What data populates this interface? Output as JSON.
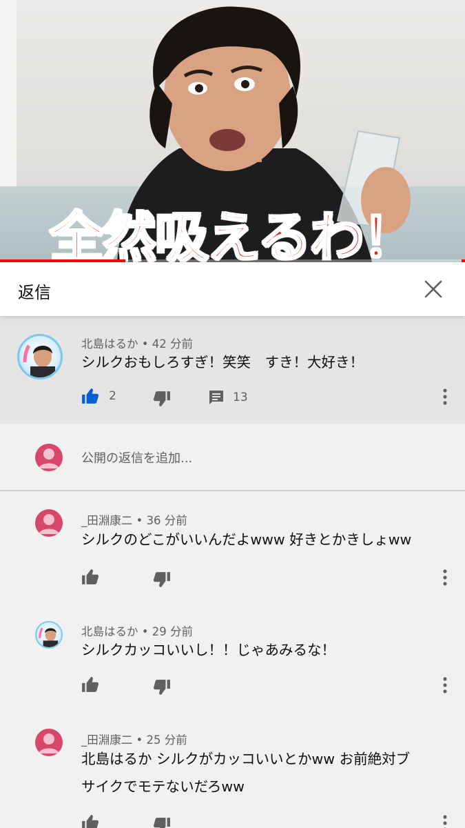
{
  "video": {
    "caption": "全然吸えるわ！",
    "progress": 0.27
  },
  "reply_panel": {
    "title": "返信",
    "close_icon": "close-icon"
  },
  "main_comment": {
    "author": "北島はるか",
    "time": "42 分前",
    "text": "シルクおもしろすぎ！笑笑　すき！大好き！",
    "likes": "2",
    "replies": "13",
    "liked": true,
    "like_color": "#065fd4"
  },
  "add_reply": {
    "placeholder": "公開の返信を追加..."
  },
  "replies": [
    {
      "author": "_田淵康二",
      "time": "36 分前",
      "text": "シルクのどこがいいんだよwww 好きとかきしょww"
    },
    {
      "author": "北島はるか",
      "time": "29 分前",
      "text": "シルクカッコいいし！！じゃあみるな！"
    },
    {
      "author": "_田淵康二",
      "time": "25 分前",
      "text_line1": "北島はるか シルクがカッコいいとかww お前絶対ブ",
      "text_line2": "サイクでモテないだろww"
    }
  ],
  "separator": " • ",
  "colors": {
    "accent_red": "#ff0000",
    "caption_red": "#e02822",
    "default_avatar": "#d6476b"
  }
}
